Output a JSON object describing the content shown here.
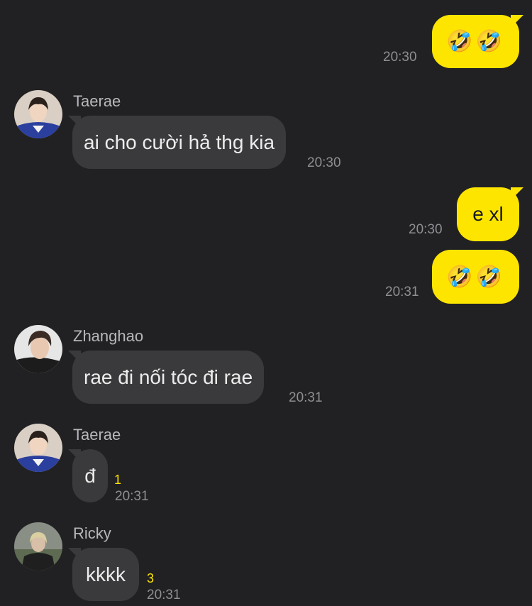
{
  "messages": [
    {
      "id": "m1",
      "direction": "out",
      "text": "🤣🤣",
      "time": "20:30"
    },
    {
      "id": "m2",
      "direction": "in",
      "sender": "Taerae",
      "text": "ai cho cười hả thg kia",
      "time": "20:30"
    },
    {
      "id": "m3",
      "direction": "out",
      "text": "e xl",
      "time": "20:30"
    },
    {
      "id": "m4",
      "direction": "out",
      "text": "🤣🤣",
      "time": "20:31"
    },
    {
      "id": "m5",
      "direction": "in",
      "sender": "Zhanghao",
      "text": "rae đi nối tóc đi rae",
      "time": "20:31"
    },
    {
      "id": "m6",
      "direction": "in",
      "sender": "Taerae",
      "text": "đ",
      "time": "20:31",
      "unread": "1"
    },
    {
      "id": "m7",
      "direction": "in",
      "sender": "Ricky",
      "text": "kkkk",
      "time": "20:31",
      "unread": "3"
    }
  ],
  "colors": {
    "background": "#212123",
    "outgoing_bubble": "#fee500",
    "incoming_bubble": "#3a3a3c",
    "unread_count": "#fee500"
  }
}
